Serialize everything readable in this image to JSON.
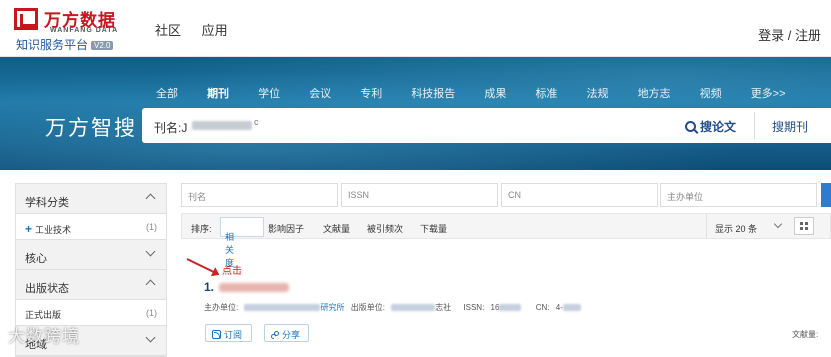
{
  "logo": {
    "name": "万方数据",
    "english": "WANFANG DATA",
    "subtitle": "知识服务平台",
    "version": "V2.0"
  },
  "topnav": {
    "items": [
      "社区",
      "应用"
    ]
  },
  "auth": {
    "label": "登录 / 注册"
  },
  "categories": [
    "全部",
    "期刊",
    "学位",
    "会议",
    "专利",
    "科技报告",
    "成果",
    "标准",
    "法规",
    "地方志",
    "视频",
    "更多>>"
  ],
  "active_category": "期刊",
  "banner": {
    "title": "万方智搜"
  },
  "search": {
    "prefix": "刊名:J",
    "tail": "c",
    "search_papers_label": "搜论文",
    "search_journals_label": "搜期刊"
  },
  "sidebar": {
    "sections": [
      {
        "title": "学科分类",
        "expanded": true,
        "items": [
          {
            "label": "工业技术",
            "count": "(1)"
          }
        ]
      },
      {
        "title": "核心",
        "expanded": false,
        "items": []
      },
      {
        "title": "出版状态",
        "expanded": true,
        "items": [
          {
            "label": "正式出版",
            "count": "(1)"
          }
        ]
      },
      {
        "title": "地域",
        "expanded": false,
        "items": []
      }
    ]
  },
  "filters": {
    "placeholders": [
      "刊名",
      "ISSN",
      "CN",
      "主办单位"
    ]
  },
  "sortbar": {
    "label": "排序:",
    "options": [
      "相关度",
      "影响因子",
      "文献量",
      "被引频次",
      "下载量"
    ],
    "active": "相关度",
    "show_label": "显示 20 条"
  },
  "annotation": {
    "text": "点击"
  },
  "result": {
    "index": "1.",
    "sponsor_label": "主办单位:",
    "sponsor_tail": "研究所",
    "publisher_label": "出版单位:",
    "publisher_tail": "志社",
    "issn_label": "ISSN:",
    "issn_value": "16",
    "cn_label": "CN:",
    "cn_value": "4-",
    "subscribe_label": "订阅",
    "share_label": "分享",
    "doc_count_label": "文献量:"
  },
  "watermark": {
    "text": "大数跨境"
  },
  "colors": {
    "brand_red": "#c8161d",
    "link_blue": "#1a74c4",
    "banner_blue": "#1f78a6",
    "title_navy": "#1f3f7a"
  }
}
